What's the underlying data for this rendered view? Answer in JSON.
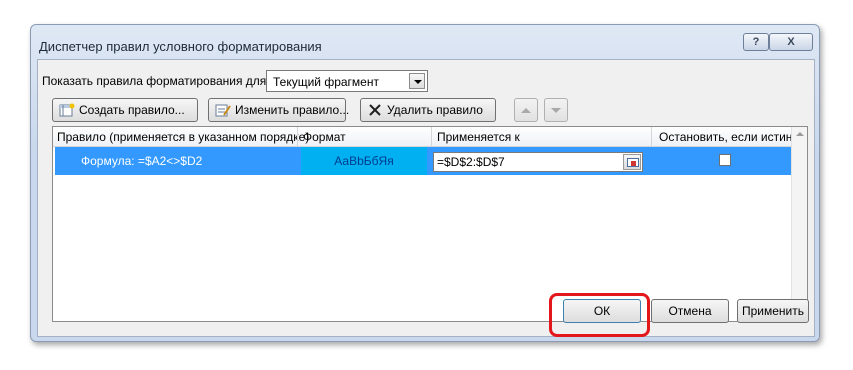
{
  "window": {
    "title": "Диспетчер правил условного форматирования",
    "help_label": "?",
    "close_label": "X"
  },
  "show_rules": {
    "label": "Показать правила форматирования для:",
    "selected": "Текущий фрагмент"
  },
  "toolbar": {
    "new_rule": "Создать правило...",
    "edit_rule": "Изменить правило...",
    "delete_rule": "Удалить правило"
  },
  "table": {
    "headers": {
      "rule": "Правило (применяется в указанном порядке)",
      "format": "Формат",
      "applies_to": "Применяется к",
      "stop_if_true": "Остановить, если истина"
    },
    "rows": [
      {
        "rule": "Формула: =$A2<>$D2",
        "format_preview": "АаВbБбЯя",
        "applies_to": "=$D$2:$D$7",
        "stop_if_true": false
      }
    ]
  },
  "footer": {
    "ok": "ОК",
    "cancel": "Отмена",
    "apply": "Применить"
  },
  "colors": {
    "selection": "#3399ff",
    "format_preview_fill": "#00b0f0",
    "highlight": "#e3171b"
  }
}
